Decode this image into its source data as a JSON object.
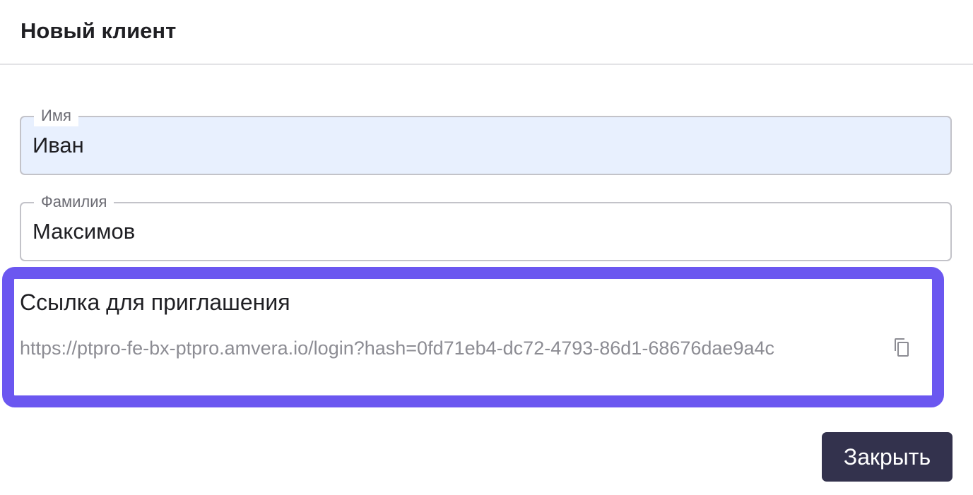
{
  "dialog": {
    "title": "Новый клиент"
  },
  "form": {
    "first_name": {
      "label": "Имя",
      "value": "Иван"
    },
    "last_name": {
      "label": "Фамилия",
      "value": "Максимов"
    }
  },
  "invite": {
    "label": "Ссылка для приглашения",
    "link": "https://ptpro-fe-bx-ptpro.amvera.io/login?hash=0fd71eb4-dc72-4793-86d1-68676dae9a4c",
    "copy_icon": "copy-icon",
    "highlight_color": "#6b57f0"
  },
  "footer": {
    "close_label": "Закрыть",
    "close_color": "#33324d"
  },
  "colors": {
    "autofill_background": "#e8f0fe"
  }
}
